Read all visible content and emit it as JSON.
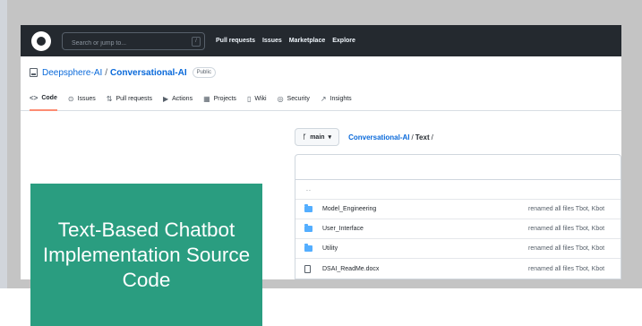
{
  "header": {
    "search_placeholder": "Search or jump to...",
    "slash_key": "/",
    "nav": [
      "Pull requests",
      "Issues",
      "Marketplace",
      "Explore"
    ]
  },
  "repo": {
    "owner": "Deepsphere-AI",
    "separator": "/",
    "name": "Conversational-AI",
    "visibility": "Public"
  },
  "tabs": [
    {
      "icon": "<>",
      "label": "Code"
    },
    {
      "icon": "⊙",
      "label": "Issues"
    },
    {
      "icon": "⇅",
      "label": "Pull requests"
    },
    {
      "icon": "▶",
      "label": "Actions"
    },
    {
      "icon": "▦",
      "label": "Projects"
    },
    {
      "icon": "▯",
      "label": "Wiki"
    },
    {
      "icon": "◎",
      "label": "Security"
    },
    {
      "icon": "↗",
      "label": "Insights"
    }
  ],
  "branch": {
    "icon": "ᚴ",
    "name": "main",
    "caret": "▾",
    "crumb_repo": "Conversational-AI",
    "crumb_sep": "/",
    "crumb_folder": "Text",
    "crumb_trailing": "/"
  },
  "files": {
    "parent": "..",
    "rows": [
      {
        "type": "folder",
        "name": "Model_Engineering",
        "message": "renamed all files Tbot, Kbot"
      },
      {
        "type": "folder",
        "name": "User_Interface",
        "message": "renamed all files Tbot, Kbot"
      },
      {
        "type": "folder",
        "name": "Utility",
        "message": "renamed all files Tbot, Kbot"
      },
      {
        "type": "file",
        "name": "DSAI_ReadMe.docx",
        "message": "renamed all files Tbot, Kbot"
      }
    ]
  },
  "callout": {
    "text": "Text-Based Chatbot Implementation Source Code",
    "color": "#2a9d80"
  }
}
